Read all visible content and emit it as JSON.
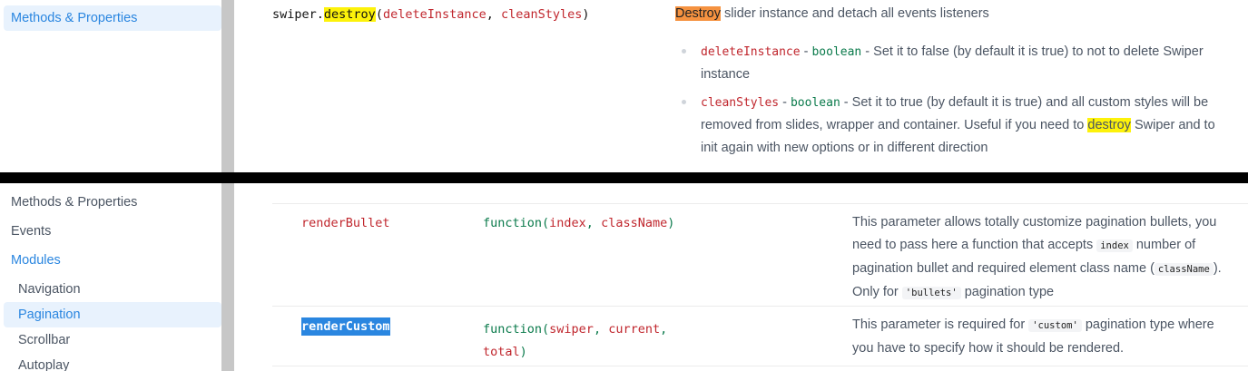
{
  "top": {
    "sidebar": {
      "active_label": "Methods & Properties"
    },
    "method": {
      "object": "swiper.",
      "name": "destroy",
      "open": "(",
      "arg1": "deleteInstance",
      "sep": ", ",
      "arg2": "cleanStyles",
      "close": ")"
    },
    "summary": {
      "highlight": "Destroy",
      "rest": " slider instance and detach all events listeners"
    },
    "params": [
      {
        "name": "deleteInstance",
        "dash": " - ",
        "type": "boolean",
        "line1": " - Set it to false (by default it is true) to not to delete Swiper",
        "line2": "instance"
      },
      {
        "name": "cleanStyles",
        "dash": " - ",
        "type": "boolean",
        "line1": " - Set it to true (by default it is true) and all custom styles will be",
        "line2a": "removed from slides, wrapper and container. Useful if you need to ",
        "line2_hl": "destroy",
        "line2b": " Swiper and to",
        "line3": "init again with new options or in different direction"
      }
    ]
  },
  "bottom": {
    "sidebar": {
      "items": [
        "Methods & Properties",
        "Events",
        "Modules"
      ],
      "sub_items": [
        "Navigation",
        "Pagination",
        "Scrollbar",
        "Autoplay"
      ]
    },
    "rows": [
      {
        "name": "renderBullet",
        "type_fn": "function(",
        "type_a1": "index",
        "type_sep": ", ",
        "type_a2": "className",
        "type_close": ")",
        "d1": "This parameter allows totally customize pagination bullets, you",
        "d2a": "need to pass here a function that accepts ",
        "d2_code": "index",
        "d2b": " number of",
        "d3a": "pagination bullet and required element class name (",
        "d3_code": "className",
        "d3b": ").",
        "d4a": "Only for ",
        "d4_code": "'bullets'",
        "d4b": " pagination type"
      },
      {
        "name": "renderCustom",
        "type_fn": "function(",
        "type_a1": "swiper",
        "type_sep": ", ",
        "type_a2": "current",
        "type_sep2": ",",
        "type_a3": "total",
        "type_close": ")",
        "d1a": "This parameter is required for ",
        "d1_code": "'custom'",
        "d1b": " pagination type where",
        "d2": "you have to specify how it should be rendered."
      }
    ]
  }
}
